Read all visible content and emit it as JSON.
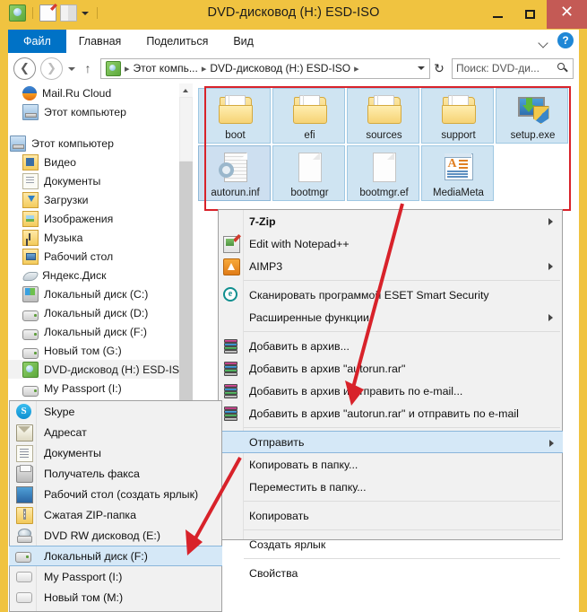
{
  "window": {
    "title": "DVD-дисковод (H:) ESD-ISO",
    "minimize_label": "−",
    "maximize_label": "□",
    "close_label": "✕",
    "titlebar_color": "#f0c340",
    "close_color": "#c45a55",
    "accent_color": "#0072c6",
    "highlight_color": "#d8222a"
  },
  "quick_access": {
    "dvd_icon": "dvd-drive-icon",
    "properties_icon": "properties-icon",
    "new_folder_icon": "new-folder-icon",
    "customize_icon": "chevron-down-icon"
  },
  "ribbon": {
    "tabs": [
      {
        "label": "Файл",
        "active": true
      },
      {
        "label": "Главная",
        "active": false
      },
      {
        "label": "Поделиться",
        "active": false
      },
      {
        "label": "Вид",
        "active": false
      }
    ],
    "collapse_icon": "chevron-down-icon",
    "help_label": "?"
  },
  "address_bar": {
    "back_label": "❮",
    "forward_label": "❯",
    "recent_icon": "chevron-down-icon",
    "up_label": "↑",
    "drive_icon": "dvd-drive-icon",
    "crumbs": [
      "Этот компь...",
      "DVD-дисковод (H:) ESD-ISO"
    ],
    "separator": "▸",
    "dropdown_icon": "chevron-down-icon",
    "refresh_label": "↻",
    "search_placeholder": "Поиск: DVD-ди...",
    "search_icon": "search-icon"
  },
  "nav_pane": {
    "scroll_up_icon": "scroll-up-arrow-icon",
    "groups": [
      {
        "items": [
          {
            "label": "Mail.Ru Cloud",
            "icon": "mailru-cloud-icon",
            "indent": 1
          },
          {
            "label": "Этот компьютер",
            "icon": "this-pc-icon",
            "indent": 1
          }
        ]
      },
      {
        "items": [
          {
            "label": "Этот компьютер",
            "icon": "this-pc-icon",
            "indent": 0
          },
          {
            "label": "Видео",
            "icon": "video-folder-icon",
            "indent": 1
          },
          {
            "label": "Документы",
            "icon": "documents-folder-icon",
            "indent": 1
          },
          {
            "label": "Загрузки",
            "icon": "downloads-folder-icon",
            "indent": 1
          },
          {
            "label": "Изображения",
            "icon": "pictures-folder-icon",
            "indent": 1
          },
          {
            "label": "Музыка",
            "icon": "music-folder-icon",
            "indent": 1
          },
          {
            "label": "Рабочий стол",
            "icon": "desktop-folder-icon",
            "indent": 1
          },
          {
            "label": "Яндекс.Диск",
            "icon": "yandex-disk-icon",
            "indent": 1
          },
          {
            "label": "Локальный диск (C:)",
            "icon": "system-drive-icon",
            "indent": 1
          },
          {
            "label": "Локальный диск (D:)",
            "icon": "hard-drive-icon",
            "indent": 1
          },
          {
            "label": "Локальный диск (F:)",
            "icon": "hard-drive-icon",
            "indent": 1
          },
          {
            "label": "Новый том (G:)",
            "icon": "hard-drive-icon",
            "indent": 1
          },
          {
            "label": "DVD-дисковод (H:) ESD-ISO",
            "icon": "dvd-drive-icon",
            "indent": 1,
            "selected": true
          },
          {
            "label": "My Passport (I:)",
            "icon": "hard-drive-icon",
            "indent": 1
          }
        ]
      }
    ]
  },
  "files": [
    {
      "name": "boot",
      "icon": "folder-icon",
      "type": "folder",
      "selected": false
    },
    {
      "name": "efi",
      "icon": "folder-icon",
      "type": "folder",
      "selected": false
    },
    {
      "name": "sources",
      "icon": "folder-icon",
      "type": "folder",
      "selected": false
    },
    {
      "name": "support",
      "icon": "folder-icon",
      "type": "folder",
      "selected": false
    },
    {
      "name": "setup.exe",
      "icon": "setup-executable-icon",
      "type": "exe",
      "selected": false
    },
    {
      "name": "autorun.inf",
      "icon": "inf-config-icon",
      "type": "inf",
      "selected": true
    },
    {
      "name": "bootmgr",
      "icon": "generic-file-icon",
      "type": "file",
      "selected": false
    },
    {
      "name": "bootmgr.ef",
      "icon": "generic-file-icon",
      "type": "file",
      "selected": false
    },
    {
      "name": "MediaMeta",
      "icon": "mediameta-xml-icon",
      "type": "xml",
      "selected": false
    }
  ],
  "context_menu": {
    "items": [
      {
        "label": "7-Zip",
        "icon": null,
        "bold": true,
        "submenu": true
      },
      {
        "label": "Edit with Notepad++",
        "icon": "notepadpp-icon",
        "submenu": false
      },
      {
        "label": "AIMP3",
        "icon": "aimp3-icon",
        "submenu": true
      },
      {
        "separator": true
      },
      {
        "label": "Сканировать программой ESET Smart Security",
        "icon": "eset-icon",
        "submenu": false
      },
      {
        "label": "Расширенные функции",
        "icon": null,
        "submenu": true
      },
      {
        "separator": true
      },
      {
        "label": "Добавить в архив...",
        "icon": "winrar-icon",
        "submenu": false
      },
      {
        "label": "Добавить в архив \"autorun.rar\"",
        "icon": "winrar-icon",
        "submenu": false
      },
      {
        "label": "Добавить в архив и отправить по e-mail...",
        "icon": "winrar-icon",
        "submenu": false
      },
      {
        "label": "Добавить в архив \"autorun.rar\" и отправить по e-mail",
        "icon": "winrar-icon",
        "submenu": false
      },
      {
        "separator": true
      },
      {
        "label": "Отправить",
        "icon": null,
        "submenu": true,
        "highlighted": true
      },
      {
        "label": "Копировать в папку...",
        "icon": null,
        "submenu": false
      },
      {
        "label": "Переместить в папку...",
        "icon": null,
        "submenu": false
      },
      {
        "separator": true
      },
      {
        "label": "Копировать",
        "icon": null,
        "submenu": false
      },
      {
        "separator": true
      },
      {
        "label": "Создать ярлык",
        "icon": null,
        "submenu": false
      },
      {
        "separator": true
      },
      {
        "label": "Свойства",
        "icon": null,
        "submenu": false
      }
    ]
  },
  "send_to_submenu": {
    "items": [
      {
        "label": "Skype",
        "icon": "skype-icon",
        "highlighted": false
      },
      {
        "label": "Адресат",
        "icon": "mail-recipient-icon",
        "highlighted": false
      },
      {
        "label": "Документы",
        "icon": "documents-icon",
        "highlighted": false
      },
      {
        "label": "Получатель факса",
        "icon": "fax-recipient-icon",
        "highlighted": false
      },
      {
        "label": "Рабочий стол (создать ярлык)",
        "icon": "desktop-shortcut-icon",
        "highlighted": false
      },
      {
        "label": "Сжатая ZIP-папка",
        "icon": "zip-folder-icon",
        "highlighted": false
      },
      {
        "label": "DVD RW дисковод (E:)",
        "icon": "dvd-rw-drive-icon",
        "highlighted": false
      },
      {
        "label": "Локальный диск (F:)",
        "icon": "hard-drive-icon",
        "highlighted": true
      },
      {
        "label": "My Passport (I:)",
        "icon": "hard-drive-icon",
        "highlighted": false
      },
      {
        "label": "Новый том (M:)",
        "icon": "hard-drive-icon",
        "highlighted": false
      }
    ]
  }
}
